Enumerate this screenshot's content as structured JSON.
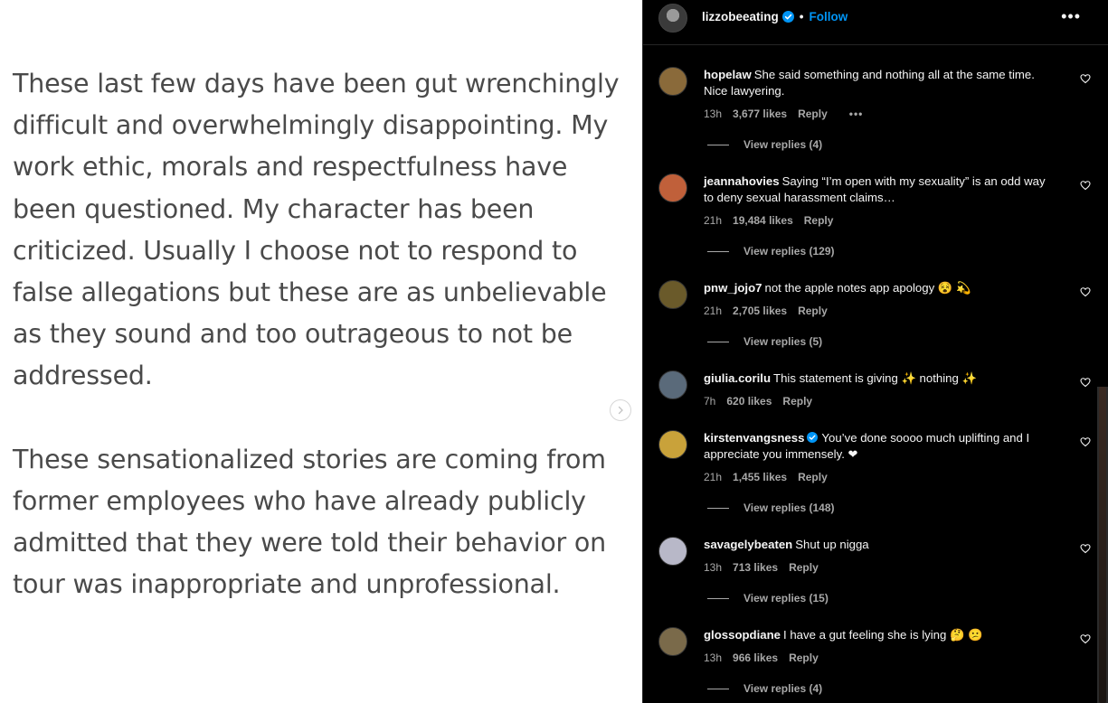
{
  "post": {
    "paragraphs": [
      "These last few days have been gut wrenchingly difficult and overwhelmingly disappointing. My work ethic, morals and respectfulness have been questioned. My character has been criticized. Usually I choose not to respond to false allegations but these are as unbelievable as they sound and too outrageous to not be addressed.",
      "These sensationalized stories are coming from former employees who have already publicly admitted that they were told their behavior on tour was inappropriate and unprofessional."
    ],
    "next_icon": "chevron-right-icon"
  },
  "header": {
    "username": "lizzobeeating",
    "separator": "•",
    "follow_label": "Follow",
    "more_label": "•••",
    "verified_color": "#0095f6"
  },
  "colors": {
    "panel_bg": "#000000",
    "text": "#f5f5f5",
    "muted": "#a8a8a8",
    "follow": "#0095f6",
    "heart_emoji": "#ed2a3a"
  },
  "comments": [
    {
      "username": "hopelaw",
      "text": "She said something and nothing all at the same time. Nice lawyering.",
      "time": "13h",
      "likes": "3,677 likes",
      "reply_label": "Reply",
      "more_label": "•••",
      "view_replies": "View replies (4)",
      "avatar_color": "#8a6a3a"
    },
    {
      "username": "jeannahovies",
      "text": "Saying “I’m open with my sexuality” is an odd way to deny sexual harassment claims…",
      "time": "21h",
      "likes": "19,484 likes",
      "reply_label": "Reply",
      "view_replies": "View replies (129)",
      "avatar_color": "#c0603a"
    },
    {
      "username": "pnw_jojo7",
      "text": "not the apple notes app apology 😵 💫",
      "time": "21h",
      "likes": "2,705 likes",
      "reply_label": "Reply",
      "view_replies": "View replies (5)",
      "avatar_color": "#6a5a2a"
    },
    {
      "username": "giulia.corilu",
      "text": "This statement is giving ✨ nothing ✨",
      "time": "7h",
      "likes": "620 likes",
      "reply_label": "Reply",
      "avatar_color": "#5a6a7a"
    },
    {
      "username": "kirstenvangsness",
      "text": "You’ve done soooo much uplifting and I appreciate you immensely. ❤",
      "time": "21h",
      "likes": "1,455 likes",
      "reply_label": "Reply",
      "view_replies": "View replies (148)",
      "avatar_color": "#c9a23a",
      "verified": true
    },
    {
      "username": "savagelybeaten",
      "text": "Shut up nigga",
      "time": "13h",
      "likes": "713 likes",
      "reply_label": "Reply",
      "view_replies": "View replies (15)",
      "avatar_color": "#b8b8c8"
    },
    {
      "username": "glossopdiane",
      "text": "I have a gut feeling she is lying 🤔 😕",
      "time": "13h",
      "likes": "966 likes",
      "reply_label": "Reply",
      "view_replies": "View replies (4)",
      "avatar_color": "#7a6a4a"
    }
  ]
}
